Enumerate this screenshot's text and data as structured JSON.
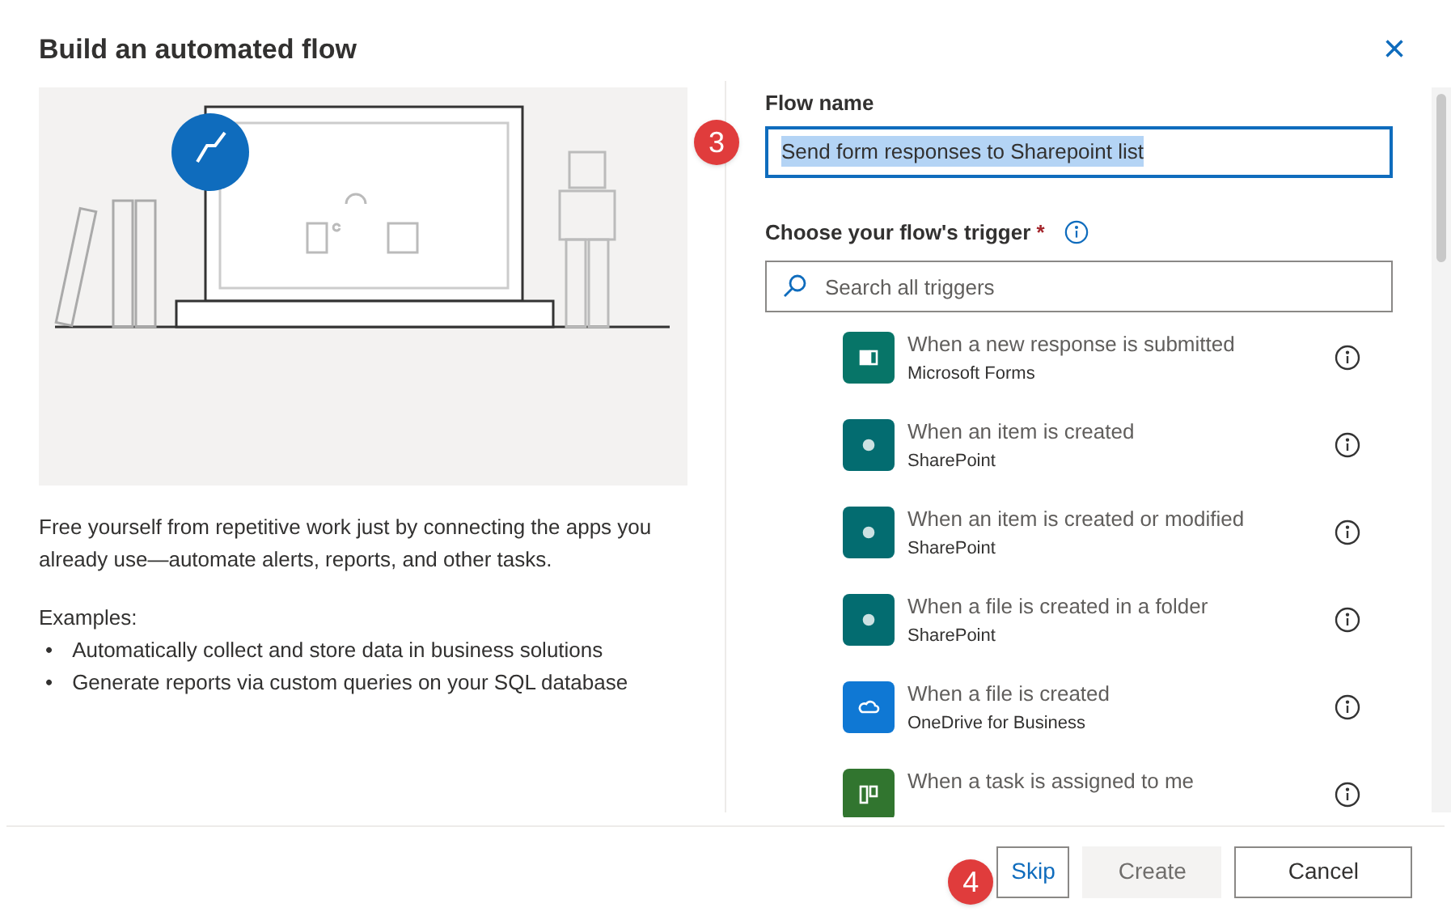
{
  "dialog": {
    "title": "Build an automated flow",
    "close_glyph": "×"
  },
  "intro": {
    "description": "Free yourself from repetitive work just by connecting the apps you already use—automate alerts, reports, and other tasks.",
    "examples_label": "Examples:",
    "examples": [
      {
        "bullet": "•",
        "text": "Automatically collect and store data in business solutions"
      },
      {
        "bullet": "•",
        "text": "Generate reports via custom queries on your SQL database"
      }
    ]
  },
  "flow_name": {
    "label": "Flow name",
    "value": "Send form responses to Sharepoint list",
    "step": "3"
  },
  "trigger": {
    "label": "Choose your flow's trigger",
    "required_mark": "*",
    "search": {
      "placeholder": "Search all triggers"
    },
    "items": [
      {
        "kind": "forms",
        "title": "When a new response is submitted",
        "app": "Microsoft Forms"
      },
      {
        "kind": "sharepoint",
        "title": "When an item is created",
        "app": "SharePoint"
      },
      {
        "kind": "sharepoint",
        "title": "When an item is created or modified",
        "app": "SharePoint"
      },
      {
        "kind": "sharepoint",
        "title": "When a file is created in a folder",
        "app": "SharePoint"
      },
      {
        "kind": "onedrive",
        "title": "When a file is created",
        "app": "OneDrive for Business"
      },
      {
        "kind": "planner",
        "title": "When a task is assigned to me"
      }
    ]
  },
  "footer": {
    "step": "4",
    "buttons": [
      {
        "kind": "link",
        "label": "Skip",
        "disabled": false
      },
      {
        "kind": "primary",
        "label": "Create",
        "disabled": true
      },
      {
        "kind": "default",
        "label": "Cancel",
        "disabled": false
      }
    ]
  }
}
